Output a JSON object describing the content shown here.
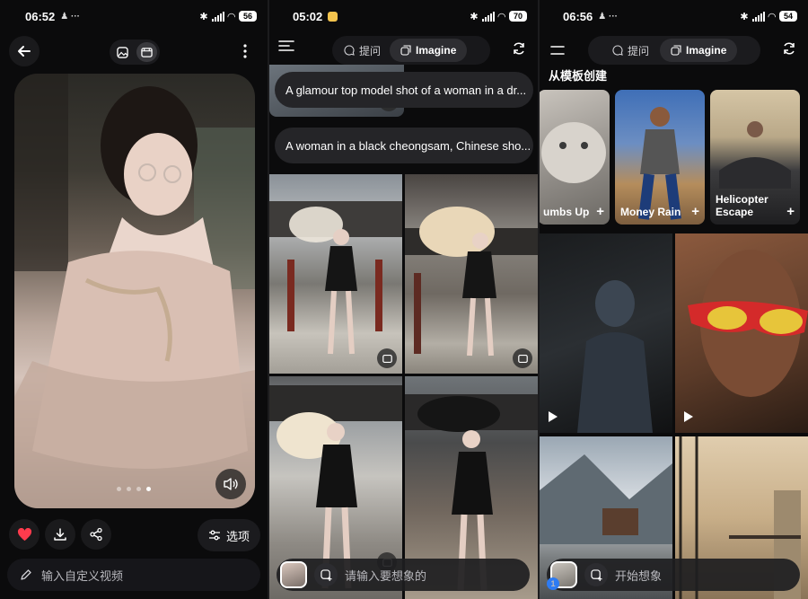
{
  "screens": [
    {
      "status": {
        "time": "06:52",
        "extra": "♟ ···",
        "battery": "56"
      },
      "toolbar": {
        "back_icon": "arrow-left-icon",
        "mode_image_icon": "image-icon",
        "mode_video_icon": "film-icon",
        "more_icon": "more-vertical-icon"
      },
      "carousel": {
        "count": 4,
        "active_index": 3
      },
      "actions": {
        "options_label": "选项"
      },
      "input": {
        "placeholder": "输入自定义视频"
      }
    },
    {
      "status": {
        "time": "05:02",
        "battery": "70"
      },
      "tabs": [
        {
          "label": "提问",
          "icon": "chat-bubble-icon"
        },
        {
          "label": "Imagine",
          "icon": "imagine-icon",
          "active": true
        }
      ],
      "prompts": [
        "A glamour top model shot of a woman in a dr...",
        "A woman in a black cheongsam, Chinese sho..."
      ],
      "input": {
        "placeholder": "请输入要想象的"
      }
    },
    {
      "status": {
        "time": "06:56",
        "extra": "♟ ···",
        "battery": "54"
      },
      "tabs": [
        {
          "label": "提问",
          "icon": "chat-bubble-icon"
        },
        {
          "label": "Imagine",
          "icon": "imagine-icon",
          "active": true
        }
      ],
      "section_title": "从模板创建",
      "templates": [
        {
          "label": "umbs Up"
        },
        {
          "label": "Money Rain"
        },
        {
          "label": "Helicopter Escape"
        }
      ],
      "input": {
        "placeholder": "开始想象",
        "attachment_count": "1"
      }
    }
  ],
  "colors": {
    "heart": "#ff3b4d",
    "panel_bg": "#0b0b0c",
    "pill_bg": "#1b1b1e"
  }
}
